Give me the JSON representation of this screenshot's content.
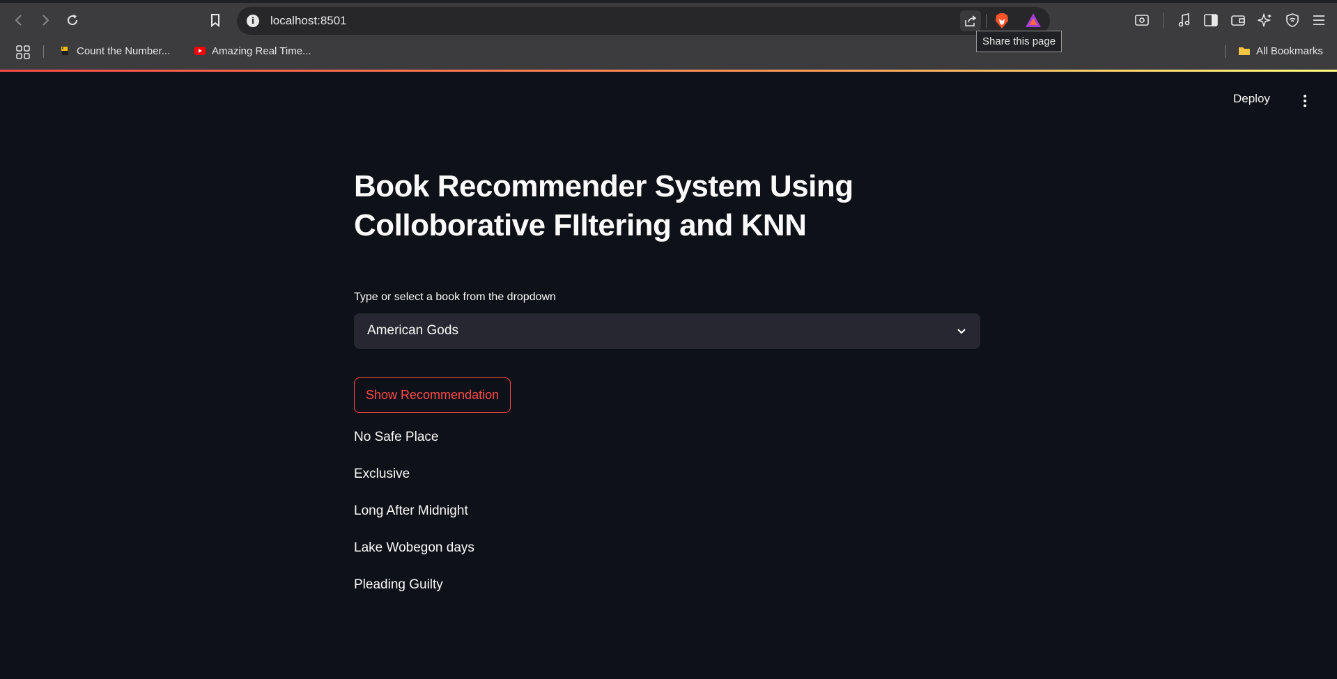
{
  "browser": {
    "url": "localhost:8501",
    "tooltip": "Share this page",
    "bookmarks": [
      {
        "label": "Count the Number...",
        "icon": "python-icon"
      },
      {
        "label": "Amazing Real Time...",
        "icon": "youtube-icon"
      }
    ],
    "all_bookmarks": "All Bookmarks"
  },
  "app": {
    "deploy_label": "Deploy",
    "title": "Book Recommender System Using Colloborative FIltering and KNN",
    "select_label": "Type or select a book from the dropdown",
    "selected_book": "American Gods",
    "button_label": "Show Recommendation",
    "recommendations": [
      "No Safe Place",
      "Exclusive",
      "Long After Midnight",
      "Lake Wobegon days",
      "Pleading Guilty"
    ]
  },
  "colors": {
    "background": "#0e1117",
    "accent": "#ff4b4b",
    "input_bg": "#262730"
  }
}
